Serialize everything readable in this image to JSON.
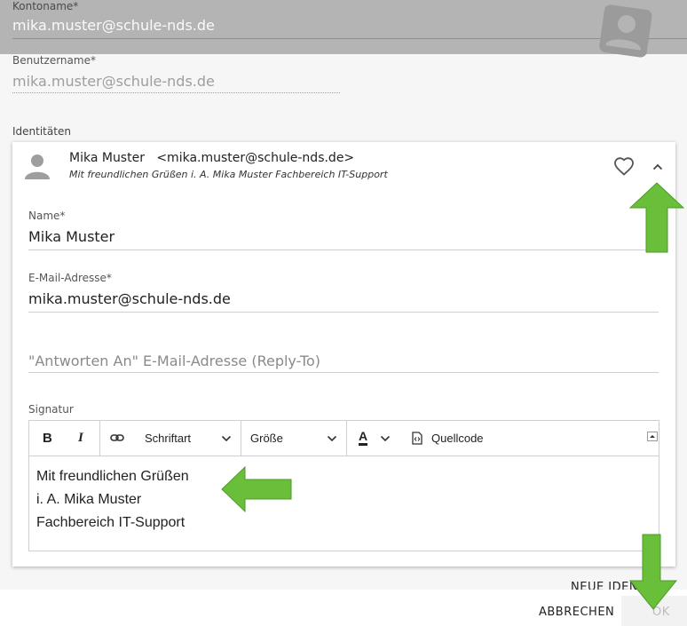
{
  "account": {
    "kontoname_label": "Kontoname",
    "kontoname_value": "mika.muster@schule-nds.de",
    "benutzername_label": "Benutzername",
    "benutzername_value": "mika.muster@schule-nds.de",
    "required_marker": "*"
  },
  "identities": {
    "section_label": "Identitäten",
    "header_name": "Mika Muster",
    "header_email": "<mika.muster@schule-nds.de>",
    "header_signature": "Mit freundlichen Grüßen i. A. Mika Muster Fachbereich IT-Support",
    "name_label": "Name",
    "name_value": "Mika Muster",
    "email_label": "E-Mail-Adresse",
    "email_value": "mika.muster@schule-nds.de",
    "reply_to_placeholder": "\"Antworten An\" E-Mail-Adresse (Reply-To)",
    "signature_label": "Signatur"
  },
  "editor": {
    "toolbar": {
      "bold": "B",
      "italic": "I",
      "font_family": "Schriftart",
      "font_size": "Größe",
      "text_color": "A",
      "source_code": "Quellcode"
    },
    "lines": [
      "Mit freundlichen Grüßen",
      "i. A. Mika Muster",
      "Fachbereich IT-Support"
    ]
  },
  "footer": {
    "new_identity": "NEUE IDENT",
    "cancel": "ABBRECHEN",
    "ok": "OK"
  },
  "colors": {
    "header_band": "#b4b4b4",
    "arrow_green": "#6abf3a",
    "card_bg": "#ffffff"
  },
  "icons": [
    "person-icon",
    "heart-icon",
    "chevron-up-icon",
    "link-icon",
    "chevron-down-icon",
    "code-file-icon",
    "collapse-icon"
  ]
}
